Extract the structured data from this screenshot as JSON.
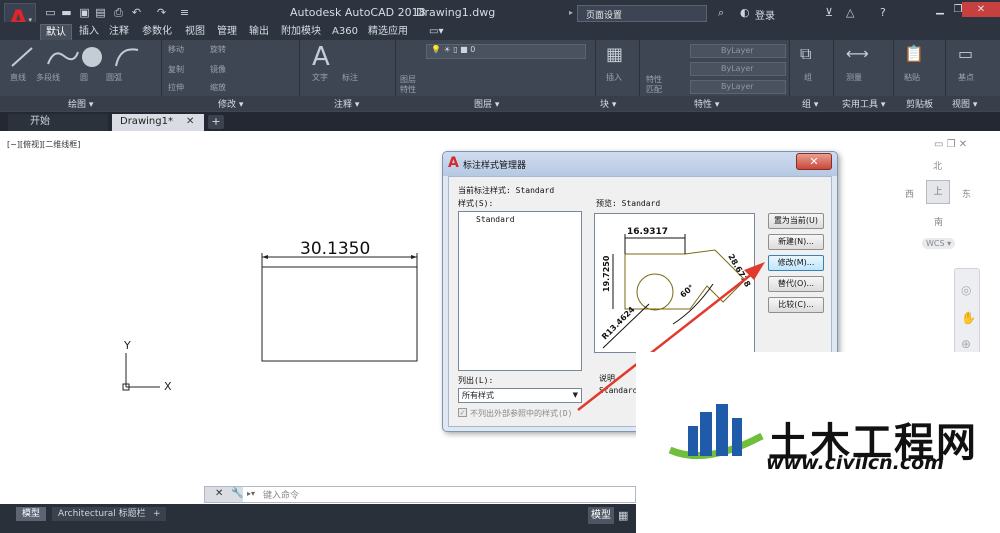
{
  "titlebar": {
    "app_title": "Autodesk AutoCAD 2018",
    "file_name": "Drawing1.dwg",
    "search_text": "页面设置",
    "login": "登录",
    "help": "?"
  },
  "ribbon": {
    "tabs": [
      "默认",
      "插入",
      "注释",
      "参数化",
      "视图",
      "管理",
      "输出",
      "附加模块",
      "A360",
      "精选应用",
      "▭▾"
    ],
    "panels": {
      "draw": "绘图 ▾",
      "modify": "修改 ▾",
      "annotation": "注释 ▾",
      "layers": "图层 ▾",
      "block": "块 ▾",
      "properties": "特性 ▾",
      "groups": "组 ▾",
      "utilities": "实用工具 ▾",
      "clipboard": "剪贴板",
      "view": "视图 ▾"
    },
    "draw_tools": [
      "直线",
      "多段线",
      "圆",
      "圆弧"
    ],
    "modify_tools": [
      "移动",
      "旋转",
      "复制",
      "镜像",
      "拉伸",
      "缩放"
    ],
    "annotation_tools": [
      "文字",
      "标注"
    ],
    "layer_tools": [
      "图层",
      "特性"
    ],
    "layer_value": "0",
    "block_tool": "插入",
    "properties_tools": [
      "特性",
      "匹配"
    ],
    "prop_values": [
      "ByLayer",
      "ByLayer",
      "ByLayer"
    ],
    "group_tool": "组",
    "utility_tool": "测量",
    "clipboard_tool": "粘贴",
    "view_tool": "基点"
  },
  "filetabs": {
    "start": "开始",
    "drawing": "Drawing1*",
    "close": "✕",
    "add": "+"
  },
  "viewport": {
    "label": "[−][俯视][二维线框]",
    "dimension_text": "30.1350",
    "ucs_y": "Y",
    "ucs_x": "X"
  },
  "viewcube": {
    "north": "北",
    "south": "南",
    "west": "西",
    "east": "东",
    "wcs": "WCS ▾"
  },
  "dialog": {
    "title": "标注样式管理器",
    "close": "✕",
    "current_style_label": "当前标注样式: Standard",
    "styles_label": "样式(S):",
    "styles": [
      "Standard"
    ],
    "preview_label": "预览: Standard",
    "list_label": "列出(L):",
    "list_value": "所有样式",
    "xref_label": "不列出外部参照中的样式(D)",
    "description_label": "说明",
    "description_value": "Standard",
    "buttons": {
      "set_current": "置为当前(U)",
      "new": "新建(N)...",
      "modify": "修改(M)...",
      "override": "替代(O)...",
      "compare": "比较(C)..."
    },
    "preview_dims": [
      "16.9317",
      "19.7250",
      "28.6718",
      "60°",
      "R13.4624"
    ]
  },
  "command": {
    "prompt": "键入命令"
  },
  "layouts": {
    "model": "模型",
    "architectural": "Architectural 标题栏",
    "add": "+",
    "status_model": "模型"
  },
  "watermark": {
    "title": "土木工程网",
    "url": "www.civilcn.com"
  },
  "colors": {
    "titlebar_bg": "#2d3440",
    "ribbon_bg": "#3f4653",
    "accent_red": "#e0262a",
    "arrow_red": "#e03a2c",
    "wm_blue": "#1f5ba8",
    "wm_green": "#6fbe3c"
  }
}
